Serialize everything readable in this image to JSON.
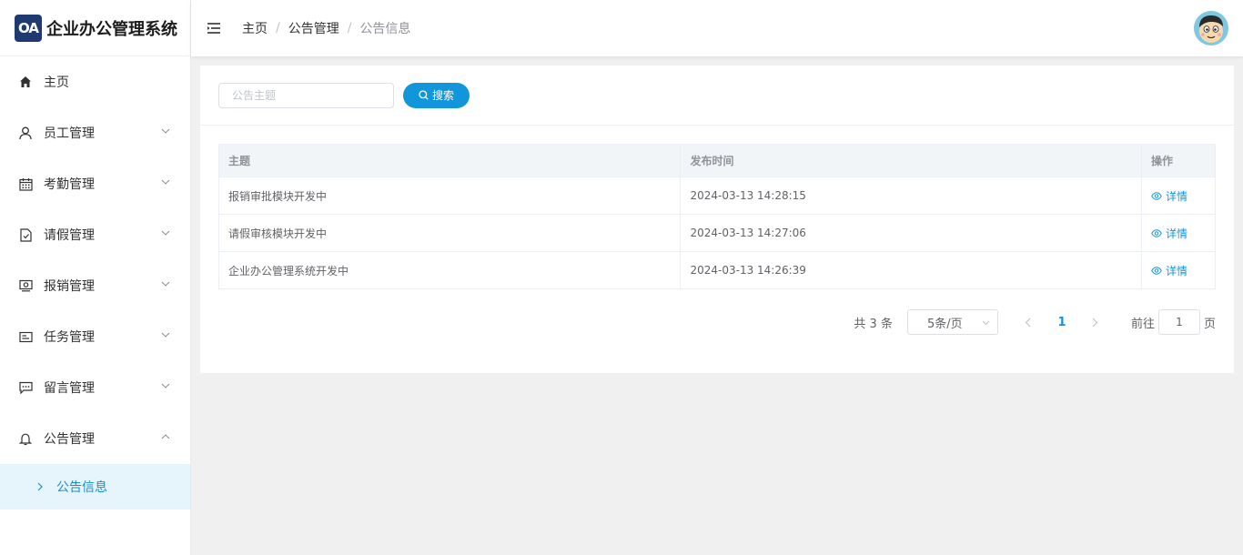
{
  "app": {
    "logo_badge": "OA",
    "title": "企业办公管理系统"
  },
  "sidebar": {
    "items": [
      {
        "label": "主页",
        "icon": "home-icon"
      },
      {
        "label": "员工管理",
        "icon": "user-icon"
      },
      {
        "label": "考勤管理",
        "icon": "calendar-icon"
      },
      {
        "label": "请假管理",
        "icon": "document-icon"
      },
      {
        "label": "报销管理",
        "icon": "money-icon"
      },
      {
        "label": "任务管理",
        "icon": "task-card-icon"
      },
      {
        "label": "留言管理",
        "icon": "chat-icon"
      },
      {
        "label": "公告管理",
        "icon": "bell-icon"
      }
    ],
    "sub_item": {
      "label": "公告信息"
    }
  },
  "header": {
    "breadcrumb": [
      "主页",
      "公告管理",
      "公告信息"
    ],
    "separator": "/"
  },
  "search": {
    "placeholder": "公告主题",
    "button_label": "搜索"
  },
  "table": {
    "columns": [
      "主题",
      "发布时间",
      "操作"
    ],
    "rows": [
      {
        "title": "报销审批模块开发中",
        "time": "2024-03-13 14:28:15",
        "action": "详情"
      },
      {
        "title": "请假审核模块开发中",
        "time": "2024-03-13 14:27:06",
        "action": "详情"
      },
      {
        "title": "企业办公管理系统开发中",
        "time": "2024-03-13 14:26:39",
        "action": "详情"
      }
    ]
  },
  "pagination": {
    "total_text": "共 3 条",
    "page_size": "5条/页",
    "current_page": "1",
    "goto_prefix": "前往",
    "goto_value": "1",
    "goto_suffix": "页"
  },
  "colors": {
    "accent": "#1296db",
    "active_bg": "#e6f4fc",
    "logo_bg": "#1f3a70"
  }
}
